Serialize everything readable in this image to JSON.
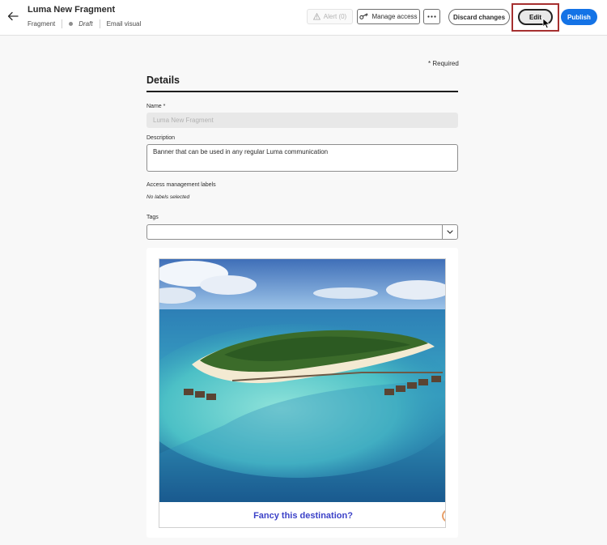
{
  "header": {
    "title": "Luma New Fragment",
    "type": "Fragment",
    "status": "Draft",
    "channel": "Email visual"
  },
  "toolbar": {
    "alert_label": "Alert (0)",
    "manage_access_label": "Manage access",
    "discard_label": "Discard changes",
    "edit_label": "Edit",
    "publish_label": "Publish"
  },
  "form": {
    "required_note": "* Required",
    "section_title": "Details",
    "name_label": "Name",
    "name_required_mark": "*",
    "name_value": "Luma New Fragment",
    "description_label": "Description",
    "description_value": "Banner that can be used in any regular Luma communication",
    "access_label": "Access management labels",
    "access_value": "No labels selected",
    "tags_label": "Tags"
  },
  "preview": {
    "caption": "Fancy this destination?"
  },
  "colors": {
    "accent": "#1473e6",
    "highlight": "#a63030",
    "caption": "#3c42c8"
  },
  "icons": {
    "back": "arrow-left-icon",
    "alert": "alert-triangle-icon",
    "manage": "key-icon",
    "more": "more-dots-icon",
    "tags_dropdown": "chevron-down-icon"
  }
}
